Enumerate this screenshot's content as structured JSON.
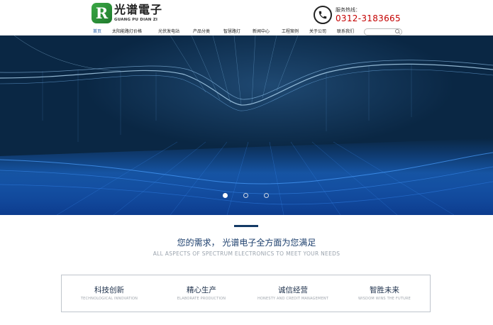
{
  "brand": {
    "logo_letter": "R",
    "name_cn": "光谱電子",
    "name_en": "GUANG PU DIAN ZI"
  },
  "hotline": {
    "label": "服务热线：",
    "number": "0312-3183665"
  },
  "nav": {
    "items": [
      {
        "label": "首页",
        "active": true
      },
      {
        "label": "太阳能路灯价格",
        "active": false
      },
      {
        "label": "光伏发电站",
        "active": false
      },
      {
        "label": "产品分类",
        "active": false
      },
      {
        "label": "智慧路灯",
        "active": false
      },
      {
        "label": "新闻中心",
        "active": false
      },
      {
        "label": "工程案例",
        "active": false
      },
      {
        "label": "关于公司",
        "active": false
      },
      {
        "label": "联系我们",
        "active": false
      }
    ]
  },
  "search": {
    "placeholder": ""
  },
  "banner": {
    "slides": 3,
    "current_slide": 1
  },
  "intro": {
    "title_cn": "您的需求，  光谱电子全方面为您满足",
    "title_en": "ALL ASPECTS OF SPECTRUM ELECTRONICS TO MEET YOUR NEEDS"
  },
  "features": [
    {
      "title": "科技创新",
      "subtitle": "TECHNOLOGICAL INNOVATION"
    },
    {
      "title": "精心生产",
      "subtitle": "ELABORATE PRODUCTION"
    },
    {
      "title": "诚信经营",
      "subtitle": "HONESTY AND CREDIT MANAGEMENT"
    },
    {
      "title": "智胜未来",
      "subtitle": "WISDOM WINS THE FUTURE"
    }
  ],
  "colors": {
    "accent": "#1f5aa6",
    "hotline": "#c40000",
    "navy": "#143a66",
    "logo_green": "#2f9a3c"
  }
}
